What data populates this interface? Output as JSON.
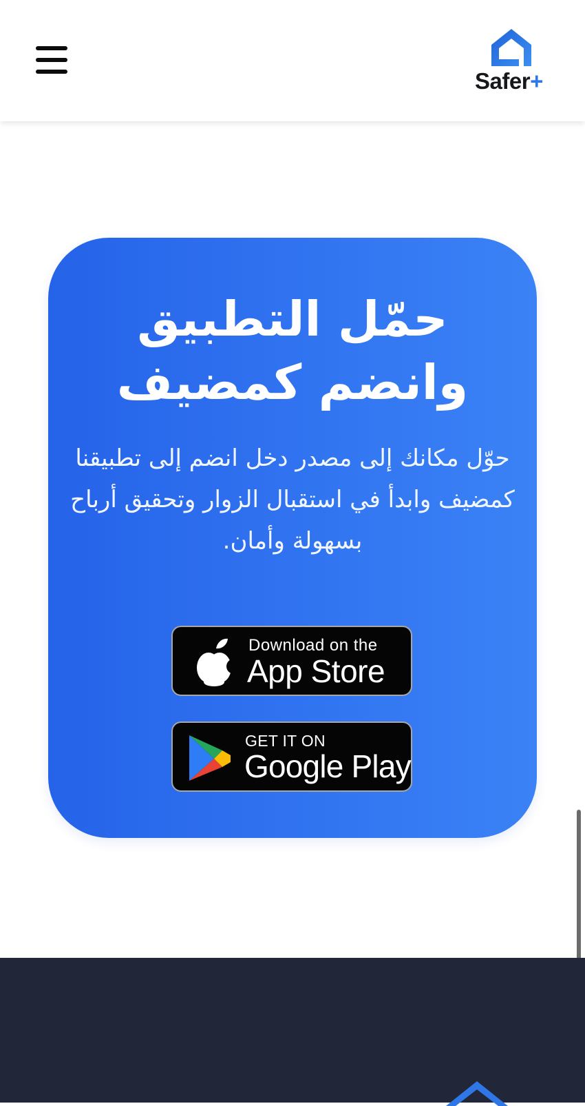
{
  "header": {
    "menu_icon": "hamburger-menu-icon",
    "logo": {
      "icon": "house-icon",
      "text": "Safer",
      "suffix": "+",
      "accent_color": "#2f77e6"
    }
  },
  "promo": {
    "title": "حمّل التطبيق وانضم كمضيف",
    "description": "حوّل مكانك إلى مصدر دخل انضم إلى تطبيقنا كمضيف وابدأ في استقبال الزوار وتحقيق أرباح بسهولة وأمان.",
    "gradient_start": "#2563e9",
    "gradient_end": "#3b82f6"
  },
  "app_store": {
    "icon": "apple-icon",
    "line1": "Download on the",
    "line2": "App Store"
  },
  "google_play": {
    "icon": "google-play-icon",
    "line1": "GET IT ON",
    "line2": "Google Play"
  },
  "footer": {
    "background": "#212638",
    "logo_icon": "house-icon"
  }
}
